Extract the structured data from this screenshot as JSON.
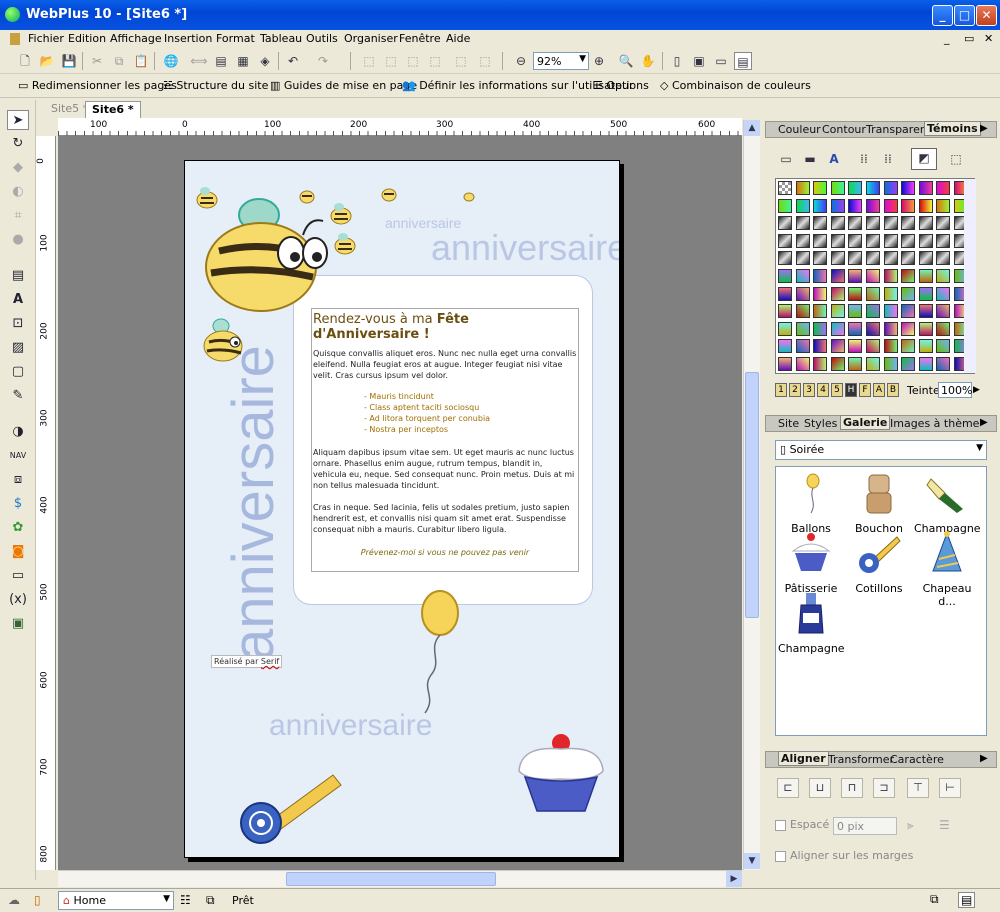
{
  "window": {
    "title": "WebPlus 10 - [Site6 *]",
    "min": "_",
    "max": "□",
    "close": "✕"
  },
  "menubar": [
    "Fichier",
    "Edition",
    "Affichage",
    "Insertion",
    "Format",
    "Tableau",
    "Outils",
    "Organiser",
    "Fenêtre",
    "Aide"
  ],
  "mdi_controls": [
    "_",
    "▭",
    "✕"
  ],
  "toolbar": {
    "zoom": "92%"
  },
  "toolbar2": {
    "resize_pages": "Redimensionner les pages",
    "site_structure": "Structure du site",
    "layout_guides": "Guides de mise en page",
    "user_info": "Définir les informations sur l'utilisateur",
    "options": "Options",
    "color_scheme": "Combinaison de couleurs"
  },
  "tabs": [
    {
      "label": "Site5 *"
    },
    {
      "label": "Site6 *"
    }
  ],
  "ruler": {
    "h": [
      "100",
      "0",
      "100",
      "200",
      "300",
      "400",
      "500",
      "600"
    ],
    "v": [
      "0",
      "100",
      "200",
      "300",
      "400",
      "500",
      "600",
      "700",
      "800"
    ]
  },
  "page": {
    "watermarks": [
      "anniversaire",
      "anniversaire",
      "anniversaire",
      "anniversaire"
    ],
    "heading_pre": "Rendez-vous à ma ",
    "heading_bold": "Fête d'Anniversaire !",
    "p1": "Quisque convallis aliquet eros. Nunc nec nulla eget urna convallis eleifend. Nulla feugiat eros at augue. Integer feugiat nisi vitae velit. Cras cursus ipsum vel dolor.",
    "list": [
      "- Mauris tincidunt",
      "- Class aptent taciti sociosqu",
      "- Ad litora torquent per conubia",
      "- Nostra per inceptos"
    ],
    "p2": "Aliquam dapibus ipsum vitae sem. Ut eget mauris ac nunc luctus ornare. Phasellus enim augue, rutrum tempus, blandit in, vehicula eu, neque. Sed consequat nunc. Proin metus. Duis at mi non tellus malesuada tincidunt.",
    "p3": "Cras in neque. Sed lacinia, felis ut sodales pretium, justo sapien hendrerit est, et convallis nisi quam sit amet erat. Suspendisse consequat nibh a mauris. Curabitur libero ligula.",
    "note": "Prévenez-moi si vous ne pouvez pas venir",
    "credit_pre": "Réalisé par ",
    "credit_link": "Serif"
  },
  "panel1": {
    "tabs": [
      "Couleur",
      "Contour",
      "Transparen",
      "Témoins"
    ],
    "tint_label": "Teinte",
    "tint_value": "100%",
    "palette_nums": [
      "1",
      "2",
      "3",
      "4",
      "5",
      "H",
      "F",
      "A",
      "B"
    ]
  },
  "panel2": {
    "tabs": [
      "Site",
      "Styles",
      "Galerie",
      "Images à thème"
    ],
    "category": "Soirée",
    "items": [
      {
        "label": "Ballons"
      },
      {
        "label": "Bouchon"
      },
      {
        "label": "Champagne"
      },
      {
        "label": "Pâtisserie"
      },
      {
        "label": "Cotillons"
      },
      {
        "label": "Chapeau d..."
      },
      {
        "label": "Champagne"
      }
    ]
  },
  "panel3": {
    "tabs": [
      "Aligner",
      "Transformer",
      "Caractère"
    ],
    "spacing_label": "Espacé",
    "spacing_value": "0 pix",
    "margins_label": "Aligner sur les marges"
  },
  "status": {
    "page": "Home",
    "text": "Prêt"
  },
  "colors": {
    "accent": "#0a5fe8",
    "heading": "#6b4f10",
    "list": "#a06d00"
  }
}
